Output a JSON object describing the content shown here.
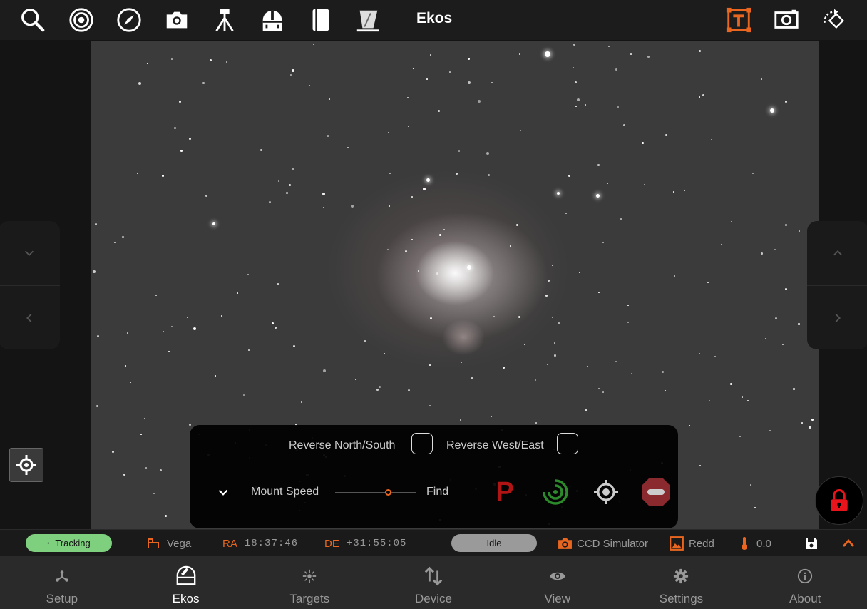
{
  "toolbar": {
    "title": "Ekos",
    "buttons": [
      "search-icon",
      "target-icon",
      "compass-icon",
      "camera-icon",
      "tripod-icon",
      "observatory-icon",
      "notebook-icon",
      "flat-panel-icon",
      "text-overlay-icon",
      "screenshot-icon",
      "rotate-icon"
    ],
    "accent": "#e8661f"
  },
  "mount_panel": {
    "reverse_ns_label": "Reverse North/South",
    "reverse_we_label": "Reverse West/East",
    "speed_label": "Mount Speed",
    "speed_value": "Find",
    "park_glyph": "P"
  },
  "status": {
    "tracking": "Tracking",
    "target": "Vega",
    "ra_label": "RA",
    "ra_value": "18:37:46",
    "de_label": "DE",
    "de_value": "+31:55:05",
    "capture_state": "Idle",
    "camera": "CCD Simulator",
    "filter": "Redd",
    "temperature": "0.0",
    "colors": {
      "tracking": "#7ed07e",
      "idle": "#9a9a9a",
      "accent": "#e8661f"
    }
  },
  "nav": [
    {
      "label": "Setup",
      "icon": "setup-icon"
    },
    {
      "label": "Ekos",
      "icon": "ekos-icon",
      "active": true
    },
    {
      "label": "Targets",
      "icon": "targets-icon"
    },
    {
      "label": "Device",
      "icon": "device-icon"
    },
    {
      "label": "View",
      "icon": "view-icon"
    },
    {
      "label": "Settings",
      "icon": "settings-icon"
    },
    {
      "label": "About",
      "icon": "about-icon"
    }
  ]
}
